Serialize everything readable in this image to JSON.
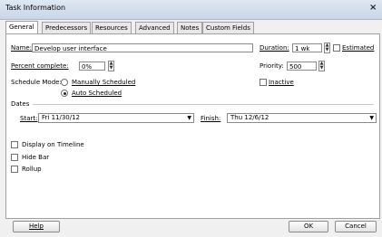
{
  "window": {
    "title": "Task Information",
    "close_glyph": "×"
  },
  "tabs": [
    "General",
    "Predecessors",
    "Resources",
    "Advanced",
    "Notes",
    "Custom Fields"
  ],
  "fields": {
    "name_label": "Name:",
    "name_value": "Develop user interface",
    "duration_label": "Duration:",
    "duration_value": "1 wk",
    "estimated_label": "Estimated",
    "percent_label": "Percent complete:",
    "percent_value": "0%",
    "priority_label": "Priority:",
    "priority_value": "500",
    "schedule_mode_label": "Schedule Mode:",
    "manual_label": "Manually Scheduled",
    "auto_label": "Auto Scheduled",
    "inactive_label": "Inactive"
  },
  "dates": {
    "section_label": "Dates",
    "start_label": "Start:",
    "start_value": "Fri 11/30/12",
    "finish_label": "Finish:",
    "finish_value": "Thu 12/6/12"
  },
  "options": {
    "timeline_label": "Display on Timeline",
    "hidebar_label": "Hide Bar",
    "rollup_label": "Rollup"
  },
  "buttons": {
    "help": "Help",
    "ok": "OK",
    "cancel": "Cancel"
  },
  "icons": {
    "dropdown": "dropdown-arrow-icon",
    "spin": "spinner-icon"
  }
}
